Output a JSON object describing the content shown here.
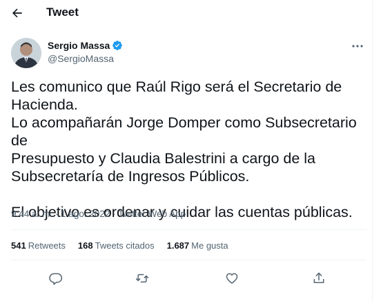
{
  "header": {
    "title": "Tweet",
    "back_icon": "arrow-left-icon"
  },
  "author": {
    "display_name": "Sergio Massa",
    "handle": "@SergioMassa",
    "verified_icon": "verified-badge-icon",
    "verified_color": "#1d9bf0"
  },
  "tweet": {
    "text": "Les comunico que Raúl Rigo será el Secretario de\nHacienda.\nLo acompañarán Jorge Domper como Subsecretario de\nPresupuesto y Claudia Balestrini a cargo de la\nSubsecretaría de Ingresos Públicos.\n\nEl objetivo es ordenar y cuidar las cuentas públicas."
  },
  "meta": {
    "time": "9:44 a. m.",
    "separator": " · ",
    "date": "1 ago. 2022",
    "source": "Twitter Web App"
  },
  "stats": {
    "retweets_count": "541",
    "retweets_label": "Retweets",
    "quotes_count": "168",
    "quotes_label": "Tweets citados",
    "likes_count": "1.687",
    "likes_label": "Me gusta"
  },
  "actions": [
    "reply-icon",
    "retweet-icon",
    "like-icon",
    "share-icon"
  ],
  "colors": {
    "text": "#0f1419",
    "secondary": "#536471",
    "divider": "#eff3f4"
  }
}
